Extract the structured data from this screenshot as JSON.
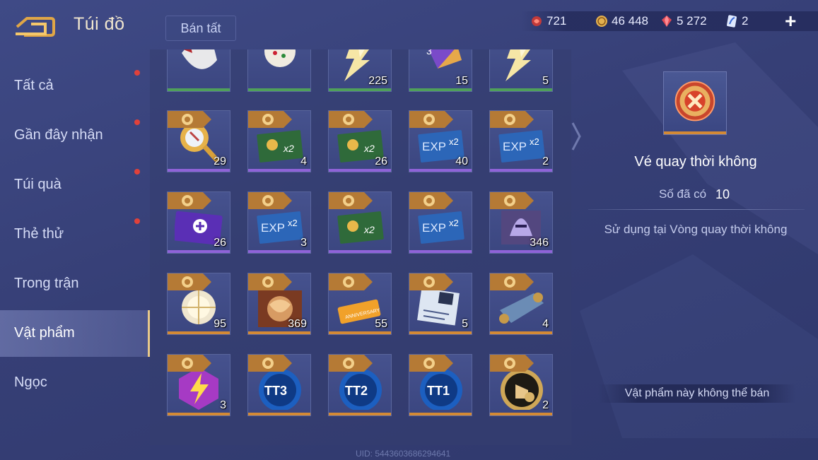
{
  "header": {
    "title": "Túi đồ",
    "sell_all_label": "Bán tất",
    "currencies": [
      {
        "icon": "red-gem-icon",
        "value": "721"
      },
      {
        "icon": "gold-coin-icon",
        "value": "46 448"
      },
      {
        "icon": "ruby-icon",
        "value": "5 272"
      },
      {
        "icon": "feather-voucher-icon",
        "value": "2"
      }
    ],
    "plus_label": "+"
  },
  "sidebar": {
    "items": [
      {
        "label": "Tất cả",
        "notify": true
      },
      {
        "label": "Gần đây nhận",
        "notify": true
      },
      {
        "label": "Túi quà",
        "notify": true
      },
      {
        "label": "Thẻ thử",
        "notify": true
      },
      {
        "label": "Trong trận",
        "notify": false
      },
      {
        "label": "Vật phẩm",
        "notify": false,
        "active": true
      },
      {
        "label": "Ngọc",
        "notify": false
      }
    ]
  },
  "grid": {
    "rows": [
      [
        {
          "icon": "white-cap-icon",
          "count": "",
          "bar": "green"
        },
        {
          "icon": "snow-globe-icon",
          "count": "",
          "bar": "green"
        },
        {
          "icon": "lightning-bolt-icon",
          "count": "225",
          "bar": "green"
        },
        {
          "icon": "purple-dice-icon",
          "count": "15",
          "bar": "green"
        },
        {
          "icon": "lightning-bolt-icon",
          "count": "5",
          "bar": "green"
        }
      ],
      [
        {
          "icon": "golden-mirror-icon",
          "count": "29",
          "bar": "purple"
        },
        {
          "icon": "gold-x2-card-icon",
          "count": "4",
          "bar": "purple"
        },
        {
          "icon": "gold-x2-card-icon",
          "count": "26",
          "bar": "purple"
        },
        {
          "icon": "exp-x2-card-icon",
          "count": "40",
          "bar": "purple"
        },
        {
          "icon": "exp-x2-card-icon",
          "count": "2",
          "bar": "purple"
        }
      ],
      [
        {
          "icon": "purple-ticket-icon",
          "count": "26",
          "bar": "purple"
        },
        {
          "icon": "exp-x2-card-icon",
          "count": "3",
          "bar": "purple"
        },
        {
          "icon": "gold-x2-card-icon",
          "count": "",
          "bar": "purple"
        },
        {
          "icon": "exp-x2-card-icon",
          "count": "",
          "bar": "purple"
        },
        {
          "icon": "knight-helmet-icon",
          "count": "346",
          "bar": "purple"
        }
      ],
      [
        {
          "icon": "crystal-orb-icon",
          "count": "95",
          "bar": "orange"
        },
        {
          "icon": "treasure-box-icon",
          "count": "369",
          "bar": "orange"
        },
        {
          "icon": "anniversary-ticket-icon",
          "count": "55",
          "bar": "orange"
        },
        {
          "icon": "voucher-card-icon",
          "count": "5",
          "bar": "orange"
        },
        {
          "icon": "scroll-map-icon",
          "count": "4",
          "bar": "orange"
        }
      ],
      [
        {
          "icon": "lightning-badge-icon",
          "count": "3",
          "bar": "orange"
        },
        {
          "icon": "tt3-medal-icon",
          "text": "TT3",
          "count": "",
          "bar": "orange"
        },
        {
          "icon": "tt2-medal-icon",
          "text": "TT2",
          "count": "",
          "bar": "orange"
        },
        {
          "icon": "tt1-medal-icon",
          "text": "TT1",
          "count": "",
          "bar": "orange"
        },
        {
          "icon": "hand-check-medal-icon",
          "count": "2",
          "bar": "orange"
        }
      ]
    ]
  },
  "uid": "UID: 5443603686294641",
  "detail": {
    "icon": "time-spin-ticket-icon",
    "name": "Vé quay thời không",
    "owned_label": "Số đã có",
    "owned_value": "10",
    "usage": "Sử dụng tại Vòng quay thời không",
    "not_sellable": "Vật phẩm này không thể bán"
  },
  "colors": {
    "bar_green": "#4fa05a",
    "bar_purple": "#8f63d8",
    "bar_orange": "#d48a35",
    "title_gold": "#f2e7cf",
    "notify_red": "#e0413a"
  }
}
